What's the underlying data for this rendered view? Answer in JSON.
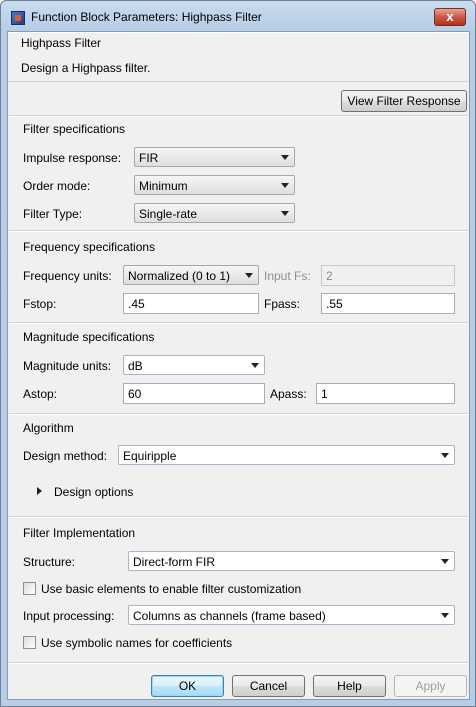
{
  "window": {
    "title": "Function Block Parameters: Highpass Filter",
    "close_glyph": "x"
  },
  "header": {
    "name": "Highpass Filter",
    "description": "Design a Highpass filter."
  },
  "view_response_label": "View Filter Response",
  "filter_specs": {
    "title": "Filter specifications",
    "impulse_label": "Impulse response:",
    "impulse_value": "FIR",
    "order_label": "Order mode:",
    "order_value": "Minimum",
    "type_label": "Filter Type:",
    "type_value": "Single-rate"
  },
  "freq_specs": {
    "title": "Frequency specifications",
    "units_label": "Frequency units:",
    "units_value": "Normalized (0 to 1)",
    "fs_label": "Input Fs:",
    "fs_value": "2",
    "fstop_label": "Fstop:",
    "fstop_value": ".45",
    "fpass_label": "Fpass:",
    "fpass_value": ".55"
  },
  "mag_specs": {
    "title": "Magnitude specifications",
    "units_label": "Magnitude units:",
    "units_value": "dB",
    "astop_label": "Astop:",
    "astop_value": "60",
    "apass_label": "Apass:",
    "apass_value": "1"
  },
  "algorithm": {
    "title": "Algorithm",
    "method_label": "Design method:",
    "method_value": "Equiripple",
    "design_options_label": "Design options"
  },
  "implementation": {
    "title": "Filter Implementation",
    "structure_label": "Structure:",
    "structure_value": "Direct-form FIR",
    "basic_elements_label": "Use basic elements to enable filter customization",
    "input_processing_label": "Input processing:",
    "input_processing_value": "Columns as channels (frame based)",
    "symbolic_label": "Use symbolic names for coefficients"
  },
  "buttons": {
    "ok": "OK",
    "cancel": "Cancel",
    "help": "Help",
    "apply": "Apply"
  }
}
